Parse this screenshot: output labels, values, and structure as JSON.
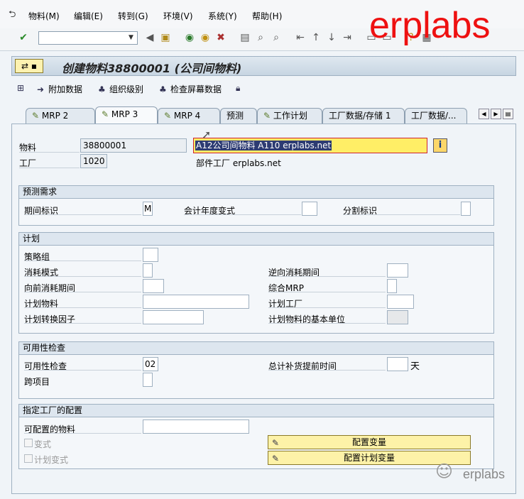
{
  "menu": [
    "物料(M)",
    "编辑(E)",
    "转到(G)",
    "环境(V)",
    "系统(Y)",
    "帮助(H)"
  ],
  "toolbar": {
    "icons": [
      "check-icon",
      "save-icon",
      "back-icon",
      "exit-icon",
      "cancel-icon",
      "print-icon",
      "find-icon",
      "find-next-icon",
      "first-page-icon",
      "prev-page-icon",
      "next-page-icon",
      "last-page-icon",
      "new-session-icon",
      "shortcut-icon",
      "help-icon",
      "settings-icon"
    ]
  },
  "watermark": "erplabs",
  "title": "创建物料38800001 (公司间物料)",
  "app_toolbar": {
    "additional_data": "附加数据",
    "org_levels": "组织级别",
    "check_screen": "检查屏幕数据"
  },
  "tabs": [
    "MRP 2",
    "MRP 3",
    "MRP 4",
    "预测",
    "工作计划",
    "工厂数据/存储 1",
    "工厂数据/..."
  ],
  "active_tab": "MRP 3",
  "header": {
    "material_label": "物料",
    "material_value": "38800001",
    "plant_label": "工厂",
    "plant_value": "1020",
    "description": "A12公司间物料 A110 erplabs.net",
    "plant_desc": "部件工厂 erplabs.net"
  },
  "forecast_group": {
    "title": "预测需求",
    "period_label": "期间标识",
    "period_value": "M",
    "fiscal_variant_label": "会计年度变式",
    "fiscal_variant_value": "",
    "split_label": "分割标识",
    "split_value": ""
  },
  "planning_group": {
    "title": "计划",
    "strategy_group_label": "策略组",
    "consumption_mode_label": "消耗模式",
    "bwd_consumption_label": "逆向消耗期间",
    "fwd_consumption_label": "向前消耗期间",
    "mixed_mrp_label": "综合MRP",
    "planning_material_label": "计划物料",
    "planning_plant_label": "计划工厂",
    "conv_factor_label": "计划转换因子",
    "planning_base_unit_label": "计划物料的基本单位"
  },
  "availability_group": {
    "title": "可用性检查",
    "check_label": "可用性检查",
    "check_value": "02",
    "total_repl_label": "总计补货提前时间",
    "total_repl_value": "",
    "total_repl_unit": "天",
    "cross_project_label": "跨项目"
  },
  "config_group": {
    "title": "指定工厂的配置",
    "configurable_material_label": "可配置的物料",
    "variant_label": "变式",
    "planning_variant_label": "计划变式",
    "configure_variant_btn": "配置变量",
    "configure_planning_variant_btn": "配置计划变量"
  },
  "wechat_watermark": "erplabs"
}
